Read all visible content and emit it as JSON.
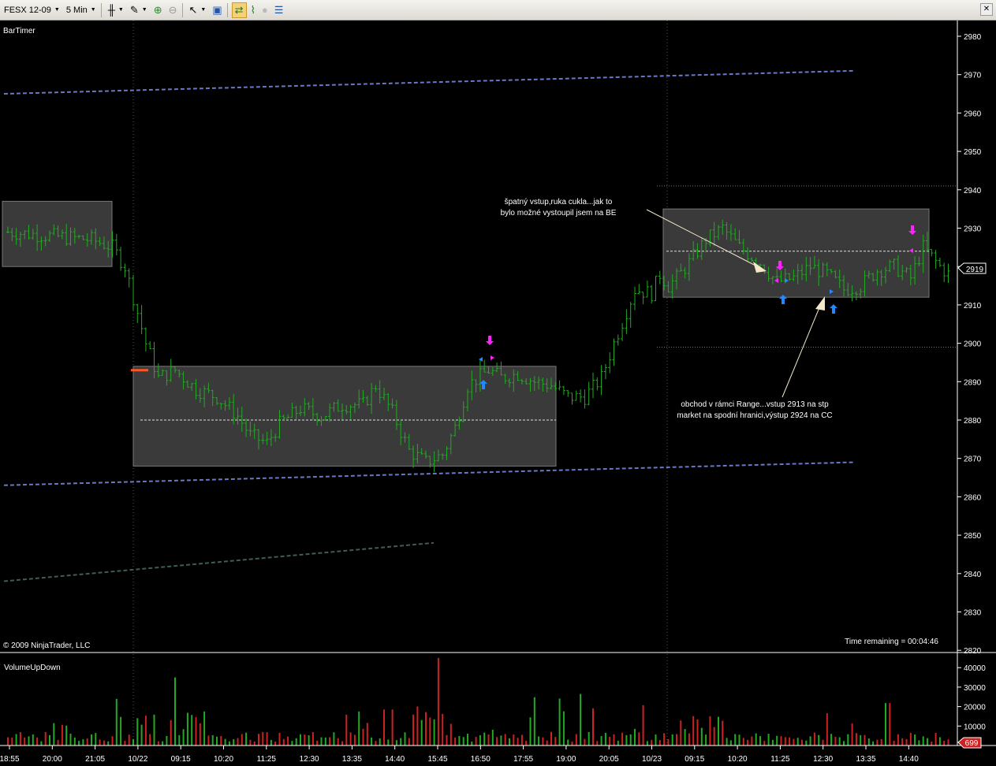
{
  "toolbar": {
    "instrument": "FESX 12-09",
    "interval": "5 Min"
  },
  "price_panel": {
    "title": "BarTimer",
    "copyright": "© 2009 NinjaTrader, LLC",
    "time_remaining": "Time remaining = 00:04:46",
    "last_price": "2919",
    "y_ticks": [
      2980,
      2970,
      2960,
      2950,
      2940,
      2930,
      2920,
      2910,
      2900,
      2890,
      2880,
      2870,
      2860,
      2850,
      2840,
      2830,
      2820
    ],
    "annotation_1": [
      "špatný vstup,ruka cukla...jak to",
      "bylo možné vystoupil jsem na BE"
    ],
    "annotation_2": [
      "obchod v rámci Range...vstup 2913 na stp",
      "market na spodní hranici,výstup 2924 na CC"
    ]
  },
  "volume_panel": {
    "title": "VolumeUpDown",
    "last_volume": "699",
    "y_ticks": [
      "40000",
      "30000",
      "20000",
      "10000"
    ]
  },
  "x_axis": {
    "labels": [
      "18:55",
      "20:00",
      "21:05",
      "10/22",
      "09:15",
      "10:20",
      "11:25",
      "12:30",
      "13:35",
      "14:40",
      "15:45",
      "16:50",
      "17:55",
      "19:00",
      "20:05",
      "10/23",
      "09:15",
      "10:20",
      "11:25",
      "12:30",
      "13:35",
      "14:40"
    ]
  },
  "colors": {
    "up_bar": "#22aa22",
    "down_bar": "#cc2222",
    "trend_line": "#6677cc",
    "range_box": "#3a3a3a",
    "marker_sell": "#ff22ff",
    "marker_buy": "#2288ff"
  },
  "chart_data": {
    "type": "candlestick",
    "price_path": [
      [
        0,
        2929
      ],
      [
        10,
        2928
      ],
      [
        20,
        2927
      ],
      [
        25,
        2925
      ],
      [
        28,
        2920
      ],
      [
        30,
        2912
      ],
      [
        33,
        2900
      ],
      [
        36,
        2891
      ],
      [
        40,
        2893
      ],
      [
        45,
        2888
      ],
      [
        50,
        2886
      ],
      [
        55,
        2881
      ],
      [
        58,
        2876
      ],
      [
        62,
        2874
      ],
      [
        65,
        2879
      ],
      [
        70,
        2883
      ],
      [
        75,
        2881
      ],
      [
        80,
        2884
      ],
      [
        85,
        2884
      ],
      [
        88,
        2889
      ],
      [
        92,
        2882
      ],
      [
        96,
        2872
      ],
      [
        100,
        2869
      ],
      [
        104,
        2871
      ],
      [
        107,
        2878
      ],
      [
        110,
        2889
      ],
      [
        115,
        2893
      ],
      [
        118,
        2891
      ],
      [
        122,
        2892
      ],
      [
        126,
        2890
      ],
      [
        130,
        2889
      ],
      [
        134,
        2886
      ],
      [
        138,
        2886
      ],
      [
        142,
        2891
      ],
      [
        145,
        2900
      ],
      [
        150,
        2914
      ],
      [
        154,
        2913
      ],
      [
        156,
        2918
      ],
      [
        158,
        2915
      ],
      [
        160,
        2917
      ],
      [
        163,
        2921
      ],
      [
        167,
        2927
      ],
      [
        171,
        2930
      ],
      [
        175,
        2925
      ],
      [
        180,
        2921
      ],
      [
        184,
        2916
      ],
      [
        188,
        2917
      ],
      [
        192,
        2920
      ],
      [
        196,
        2918
      ],
      [
        200,
        2914
      ],
      [
        204,
        2915
      ],
      [
        208,
        2919
      ],
      [
        212,
        2920
      ],
      [
        216,
        2917
      ],
      [
        219,
        2925
      ],
      [
        223,
        2920
      ],
      [
        225,
        2918
      ]
    ],
    "range_box_1": [
      2868,
      2894
    ],
    "range_box_2": [
      2912,
      2935
    ],
    "upper_trend": [
      2965,
      2971
    ],
    "lower_trend": [
      2863,
      2869
    ],
    "dotted_levels": [
      2941,
      2899
    ],
    "volume_peak": 45000
  }
}
